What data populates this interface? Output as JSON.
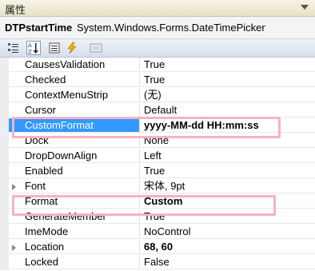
{
  "panel": {
    "title": "属性"
  },
  "object": {
    "name": "DTPstartTime",
    "type": "System.Windows.Forms.DateTimePicker"
  },
  "toolbar": {
    "buttons": [
      "categorized-icon",
      "alphabetical-icon",
      "properties-icon",
      "events-icon",
      "property-pages-icon"
    ]
  },
  "rows": [
    {
      "name": "CausesValidation",
      "value": "True"
    },
    {
      "name": "Checked",
      "value": "True"
    },
    {
      "name": "ContextMenuStrip",
      "value": "(无)"
    },
    {
      "name": "Cursor",
      "value": "Default"
    },
    {
      "name": "CustomFormat",
      "value": "yyyy-MM-dd HH:mm:ss",
      "selected": true,
      "bold_value": true
    },
    {
      "name": "Dock",
      "value": "None"
    },
    {
      "name": "DropDownAlign",
      "value": "Left"
    },
    {
      "name": "Enabled",
      "value": "True"
    },
    {
      "name": "Font",
      "value": "宋体, 9pt",
      "expandable": true
    },
    {
      "name": "Format",
      "value": "Custom",
      "bold_value": true
    },
    {
      "name": "GenerateMember",
      "value": "True"
    },
    {
      "name": "ImeMode",
      "value": "NoControl"
    },
    {
      "name": "Location",
      "value": "68, 60",
      "expandable": true,
      "bold_value": true
    },
    {
      "name": "Locked",
      "value": "False"
    }
  ],
  "colors": {
    "selection": "#3399ff",
    "highlight_box": "#f4b3c6"
  }
}
